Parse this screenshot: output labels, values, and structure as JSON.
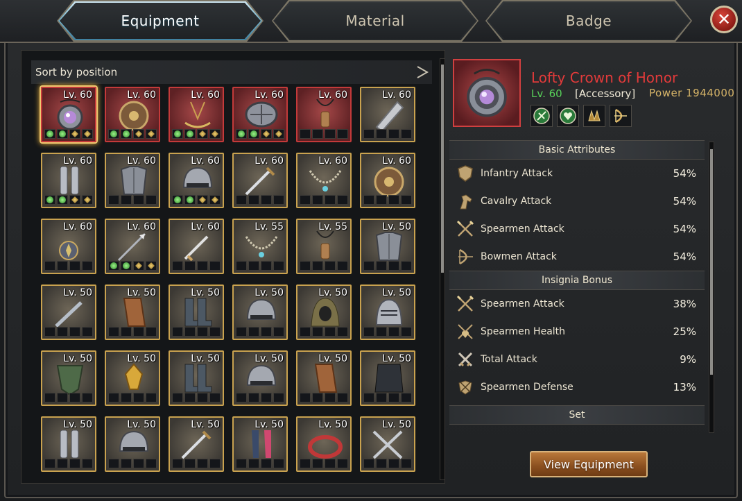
{
  "tabs": [
    {
      "label": "Equipment",
      "active": true
    },
    {
      "label": "Material",
      "active": false
    },
    {
      "label": "Badge",
      "active": false
    }
  ],
  "close_icon": "close-icon",
  "inventory": {
    "sort_label": "Sort by position",
    "items": [
      {
        "level": "Lv. 60",
        "icon": "amulet-orb",
        "rarity": "red",
        "selected": true,
        "sockets": [
          "green",
          "green",
          "gold",
          "gold"
        ]
      },
      {
        "level": "Lv. 60",
        "icon": "round-shield",
        "rarity": "red",
        "sockets": [
          "green",
          "green",
          "gold",
          "gold"
        ]
      },
      {
        "level": "Lv. 60",
        "icon": "talisman",
        "rarity": "red",
        "sockets": [
          "green",
          "green",
          "gold",
          "gold"
        ]
      },
      {
        "level": "Lv. 60",
        "icon": "buckler",
        "rarity": "red",
        "sockets": [
          "green",
          "green",
          "gold",
          "gold"
        ]
      },
      {
        "level": "Lv. 60",
        "icon": "pendant",
        "rarity": "red",
        "sockets": [
          "empty",
          "empty",
          "empty",
          "empty"
        ]
      },
      {
        "level": "Lv. 60",
        "icon": "gauntlet",
        "rarity": "gold",
        "sockets": [
          "empty",
          "empty",
          "empty",
          "empty"
        ]
      },
      {
        "level": "Lv. 60",
        "icon": "greaves",
        "rarity": "gold",
        "sockets": [
          "green",
          "green",
          "gold",
          "gold"
        ]
      },
      {
        "level": "Lv. 60",
        "icon": "plate-armor",
        "rarity": "gold",
        "sockets": [
          "empty",
          "empty",
          "empty",
          "empty"
        ]
      },
      {
        "level": "Lv. 60",
        "icon": "helmet",
        "rarity": "gold",
        "sockets": [
          "green",
          "green",
          "gold",
          "gold"
        ]
      },
      {
        "level": "Lv. 60",
        "icon": "sword",
        "rarity": "gold",
        "sockets": [
          "empty",
          "empty",
          "empty",
          "empty"
        ]
      },
      {
        "level": "Lv. 60",
        "icon": "necklace",
        "rarity": "gold",
        "sockets": [
          "empty",
          "empty",
          "empty",
          "empty"
        ]
      },
      {
        "level": "Lv. 60",
        "icon": "round-shield",
        "rarity": "gold",
        "sockets": [
          "empty",
          "empty",
          "empty",
          "empty"
        ]
      },
      {
        "level": "Lv. 60",
        "icon": "amulet",
        "rarity": "gold",
        "sockets": [
          "empty",
          "empty",
          "empty",
          "empty"
        ]
      },
      {
        "level": "Lv. 60",
        "icon": "spear",
        "rarity": "gold",
        "sockets": [
          "green",
          "green",
          "gold",
          "gold"
        ]
      },
      {
        "level": "Lv. 60",
        "icon": "dagger",
        "rarity": "gold",
        "sockets": [
          "empty",
          "empty",
          "empty",
          "empty"
        ]
      },
      {
        "level": "Lv. 55",
        "icon": "necklace",
        "rarity": "gold",
        "sockets": [
          "empty",
          "empty",
          "empty",
          "empty"
        ]
      },
      {
        "level": "Lv. 55",
        "icon": "pendant",
        "rarity": "gold",
        "sockets": [
          "empty",
          "empty",
          "empty",
          "empty"
        ]
      },
      {
        "level": "Lv. 50",
        "icon": "plate-armor",
        "rarity": "gold",
        "sockets": [
          "empty",
          "empty",
          "empty",
          "empty"
        ]
      },
      {
        "level": "Lv. 50",
        "icon": "knife",
        "rarity": "gold",
        "sockets": [
          "empty",
          "empty",
          "empty",
          "empty"
        ]
      },
      {
        "level": "Lv. 50",
        "icon": "bracer",
        "rarity": "gold",
        "sockets": [
          "empty",
          "empty",
          "empty",
          "empty"
        ]
      },
      {
        "level": "Lv. 50",
        "icon": "boots",
        "rarity": "gold",
        "sockets": [
          "empty",
          "empty",
          "empty",
          "empty"
        ]
      },
      {
        "level": "Lv. 50",
        "icon": "helmet",
        "rarity": "gold",
        "sockets": [
          "empty",
          "empty",
          "empty",
          "empty"
        ]
      },
      {
        "level": "Lv. 50",
        "icon": "hood",
        "rarity": "gold",
        "sockets": [
          "empty",
          "empty",
          "empty",
          "empty"
        ]
      },
      {
        "level": "Lv. 50",
        "icon": "visor-helmet",
        "rarity": "gold",
        "sockets": [
          "empty",
          "empty",
          "empty",
          "empty"
        ]
      },
      {
        "level": "Lv. 50",
        "icon": "scale-shield",
        "rarity": "gold",
        "sockets": [
          "empty",
          "empty",
          "empty",
          "empty"
        ]
      },
      {
        "level": "Lv. 50",
        "icon": "golden-crest",
        "rarity": "gold",
        "sockets": [
          "empty",
          "empty",
          "empty",
          "empty"
        ]
      },
      {
        "level": "Lv. 50",
        "icon": "boots",
        "rarity": "gold",
        "sockets": [
          "empty",
          "empty",
          "empty",
          "empty"
        ]
      },
      {
        "level": "Lv. 50",
        "icon": "helmet",
        "rarity": "gold",
        "sockets": [
          "empty",
          "empty",
          "empty",
          "empty"
        ]
      },
      {
        "level": "Lv. 50",
        "icon": "bracer",
        "rarity": "gold",
        "sockets": [
          "empty",
          "empty",
          "empty",
          "empty"
        ]
      },
      {
        "level": "Lv. 50",
        "icon": "cloak",
        "rarity": "gold",
        "sockets": [
          "empty",
          "empty",
          "empty",
          "empty"
        ]
      },
      {
        "level": "Lv. 50",
        "icon": "greaves",
        "rarity": "gold",
        "sockets": [
          "empty",
          "empty",
          "empty",
          "empty"
        ]
      },
      {
        "level": "Lv. 50",
        "icon": "helmet",
        "rarity": "gold",
        "sockets": [
          "empty",
          "empty",
          "empty",
          "empty"
        ]
      },
      {
        "level": "Lv. 50",
        "icon": "sword",
        "rarity": "gold",
        "sockets": [
          "empty",
          "empty",
          "empty",
          "empty"
        ]
      },
      {
        "level": "Lv. 50",
        "icon": "leggings",
        "rarity": "gold",
        "sockets": [
          "empty",
          "empty",
          "empty",
          "empty"
        ]
      },
      {
        "level": "Lv. 50",
        "icon": "ring-band",
        "rarity": "gold",
        "sockets": [
          "empty",
          "empty",
          "empty",
          "empty"
        ]
      },
      {
        "level": "Lv. 50",
        "icon": "crossed-blades",
        "rarity": "gold",
        "sockets": [
          "empty",
          "empty",
          "empty",
          "empty"
        ]
      }
    ]
  },
  "detail": {
    "name": "Lofty Crown of Honor",
    "level": "Lv. 60",
    "type": "[Accessory]",
    "power": "Power 1944000",
    "insignias": [
      "green-feather-icon",
      "green-heart-icon",
      "gold-claw-icon",
      "gold-bow-icon"
    ],
    "basic_title": "Basic Attributes",
    "basic": [
      {
        "name": "Infantry Attack",
        "value": "54%",
        "icon": "shield-icon"
      },
      {
        "name": "Cavalry Attack",
        "value": "54%",
        "icon": "horse-icon"
      },
      {
        "name": "Spearmen Attack",
        "value": "54%",
        "icon": "crossed-spears-icon"
      },
      {
        "name": "Bowmen Attack",
        "value": "54%",
        "icon": "bow-icon"
      }
    ],
    "insignia_title": "Insignia Bonus",
    "insignia_bonus": [
      {
        "name": "Spearmen Attack",
        "value": "38%",
        "icon": "crossed-spears-icon"
      },
      {
        "name": "Spearmen Health",
        "value": "25%",
        "icon": "spear-heart-icon"
      },
      {
        "name": "Total Attack",
        "value": "9%",
        "icon": "crossed-swords-icon"
      },
      {
        "name": "Spearmen Defense",
        "value": "13%",
        "icon": "spear-shield-icon"
      }
    ],
    "set_title": "Set",
    "view_button": "View Equipment"
  }
}
